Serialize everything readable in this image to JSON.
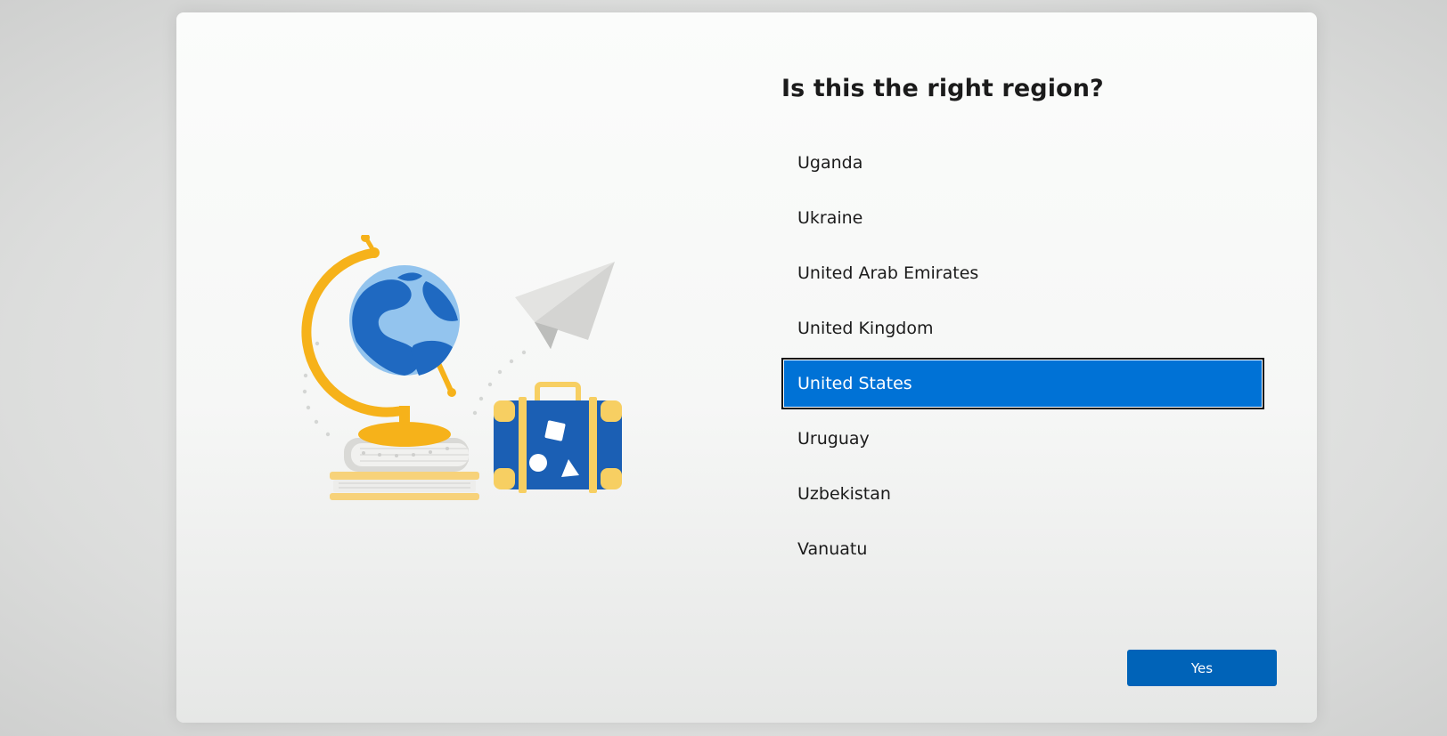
{
  "dialog": {
    "title": "Is this the right region?"
  },
  "regions": {
    "items": [
      {
        "label": "Uganda"
      },
      {
        "label": "Ukraine"
      },
      {
        "label": "United Arab Emirates"
      },
      {
        "label": "United Kingdom"
      },
      {
        "label": "United States"
      },
      {
        "label": "Uruguay"
      },
      {
        "label": "Uzbekistan"
      },
      {
        "label": "Vanuatu"
      }
    ],
    "selected": "United States"
  },
  "footer": {
    "yes_label": "Yes"
  },
  "illustration": {
    "icons": [
      "globe-icon",
      "books-icon",
      "paper-plane-icon",
      "suitcase-icon"
    ]
  },
  "colors": {
    "accent": "#0072d6",
    "button": "#0063b8",
    "globe_frame": "#f6b21a",
    "globe_water": "#93c4ee",
    "globe_land": "#1f69c1",
    "suitcase": "#1b5fb4",
    "suitcase_trim": "#f7cf62"
  }
}
